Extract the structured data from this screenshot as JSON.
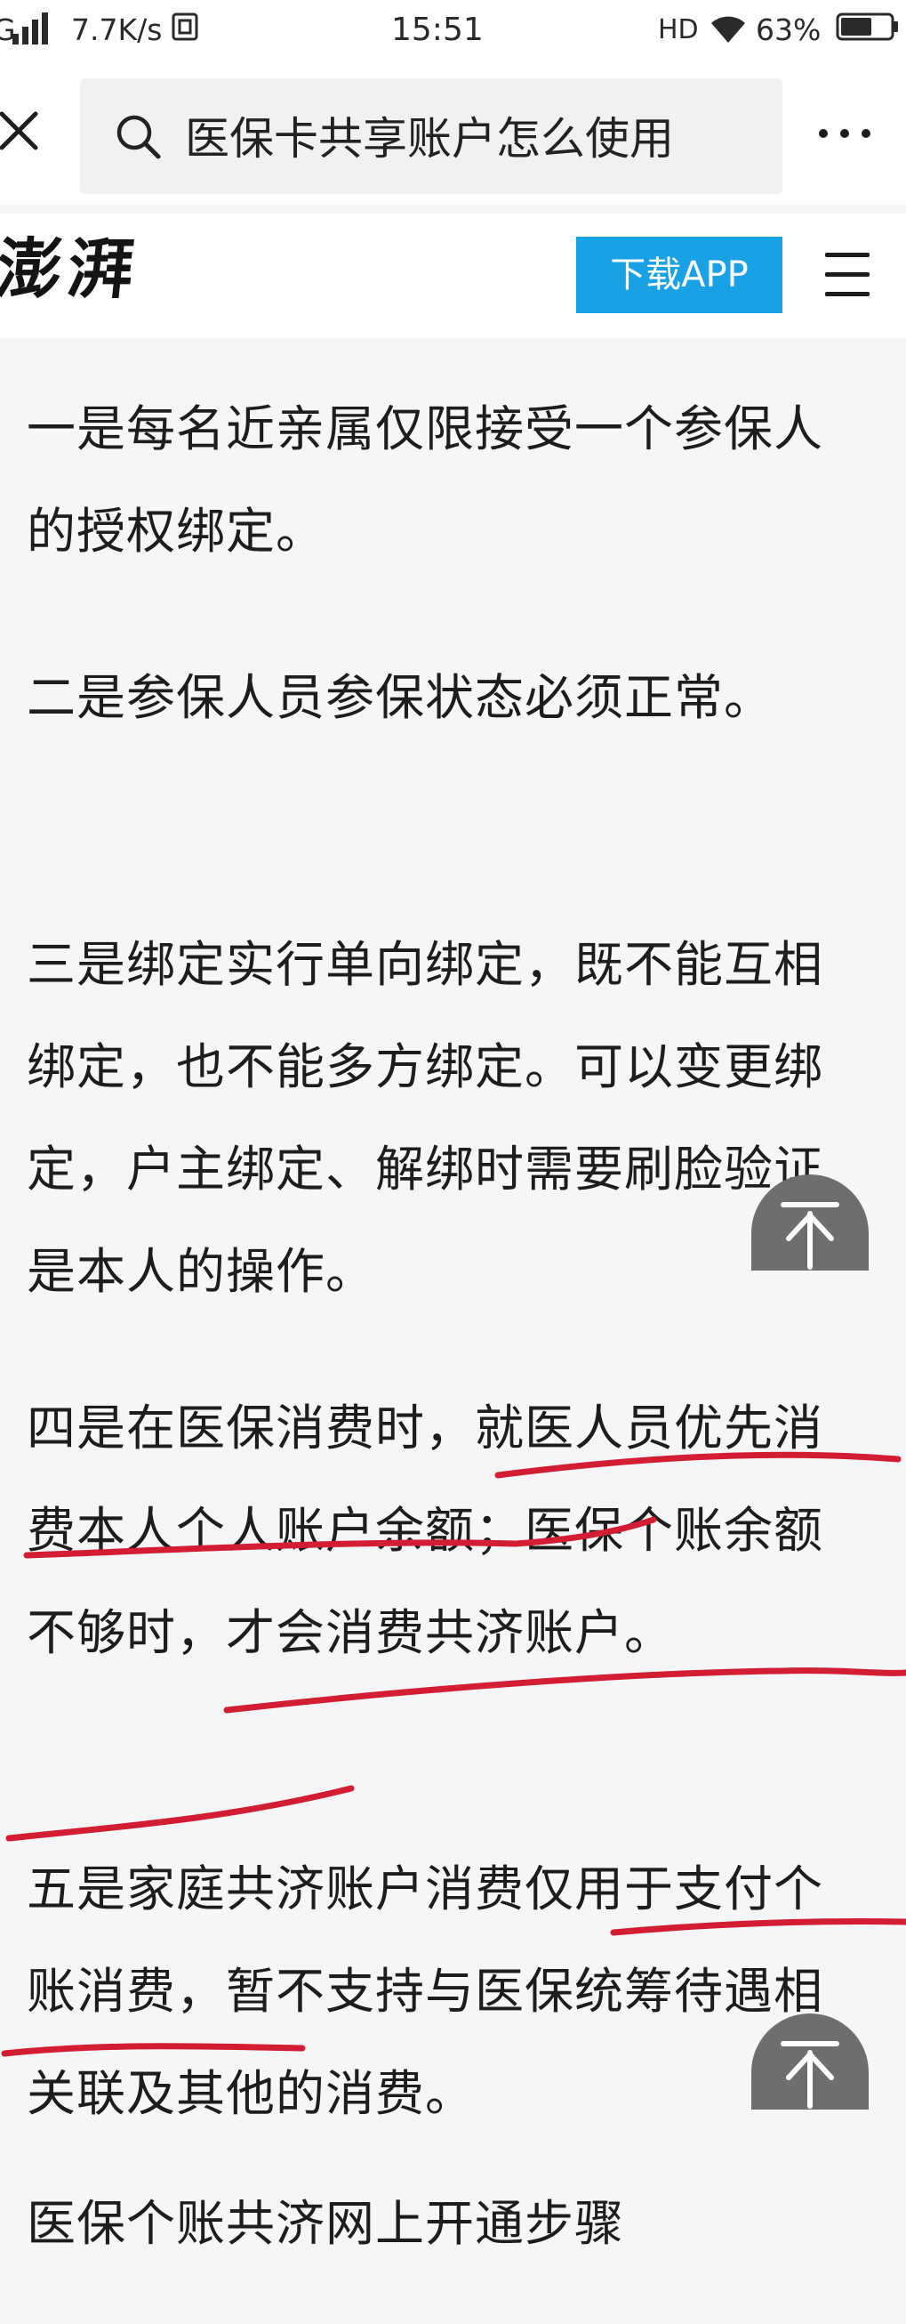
{
  "status_bar": {
    "signal": "G",
    "net_speed": "7.7K/s",
    "time": "15:51",
    "hd_label": "HD",
    "battery_percent": "63%",
    "battery_level": 0.63
  },
  "browser": {
    "search_query": "医保卡共享账户怎么使用"
  },
  "site": {
    "logo": "澎湃",
    "download_button": "下载APP"
  },
  "article": {
    "paragraphs": [
      "一是每名近亲属仅限接受一个参保人的授权绑定。",
      "二是参保人员参保状态必须正常。",
      "三是绑定实行单向绑定，既不能互相绑定，也不能多方绑定。可以变更绑定，户主绑定、解绑时需要刷脸验证是本人的操作。",
      "四是在医保消费时，就医人员优先消费本人个人账户余额；医保个账余额不够时，才会消费共济账户。",
      "五是家庭共济账户消费仅用于支付个账消费，暂不支持与医保统筹待遇相关联及其他的消费。",
      "医保个账共济网上开通步骤"
    ]
  },
  "colors": {
    "accent": "#19a1e6",
    "ink": "#d21d33",
    "background": "#f6f5f8"
  },
  "icons": {
    "close": "close-icon",
    "search": "search-icon",
    "more": "more-dots-icon",
    "menu": "hamburger-menu-icon",
    "back_to_top": "arrow-up-icon",
    "wifi": "wifi-icon",
    "battery": "battery-icon"
  }
}
